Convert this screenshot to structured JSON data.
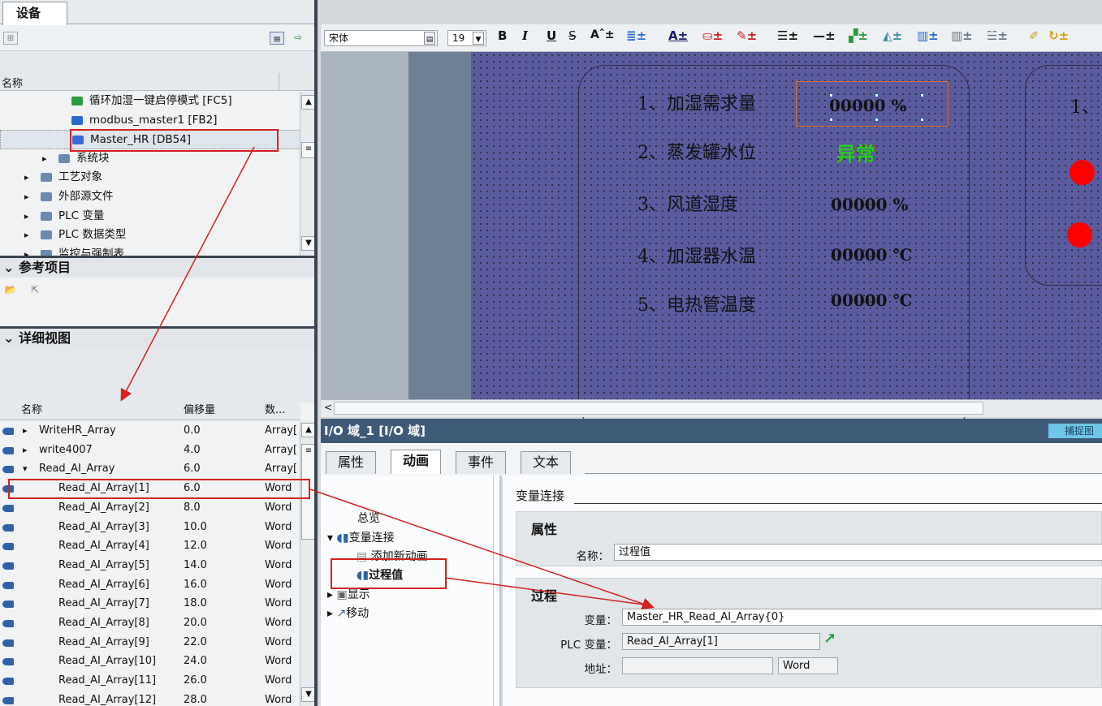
{
  "left_panel": {
    "tab_label": "设备",
    "tree_header": "名称",
    "tree_items": [
      {
        "label": "循环加湿一键启停模式 [FC5]",
        "indent": 88,
        "arrow": "",
        "icon": "fc-icon"
      },
      {
        "label": "modbus_master1 [FB2]",
        "indent": 88,
        "arrow": "",
        "icon": "fb-icon"
      },
      {
        "label": "Master_HR [DB54]",
        "indent": 88,
        "arrow": "",
        "icon": "db-icon"
      },
      {
        "label": "系统块",
        "indent": 72,
        "arrow": "▸",
        "icon": "folder-icon"
      },
      {
        "label": "工艺对象",
        "indent": 50,
        "arrow": "▸",
        "icon": "folder-icon"
      },
      {
        "label": "外部源文件",
        "indent": 50,
        "arrow": "▸",
        "icon": "folder-icon"
      },
      {
        "label": "PLC 变量",
        "indent": 50,
        "arrow": "▸",
        "icon": "folder-icon"
      },
      {
        "label": "PLC 数据类型",
        "indent": 50,
        "arrow": "▸",
        "icon": "folder-icon"
      },
      {
        "label": "监控与强制表",
        "indent": 50,
        "arrow": "▸",
        "icon": "folder-icon"
      }
    ],
    "ref_panel_title": "参考项目",
    "detail_panel_title": "详细视图",
    "detail_headers": {
      "name": "名称",
      "offset": "偏移量",
      "type": "数..."
    },
    "detail_rows": [
      {
        "arrow": "▸",
        "name": "WriteHR_Array",
        "offset": "0.0",
        "type": "Array[",
        "indent": 48
      },
      {
        "arrow": "▸",
        "name": "write4007",
        "offset": "4.0",
        "type": "Array[",
        "indent": 48
      },
      {
        "arrow": "▾",
        "name": "Read_AI_Array",
        "offset": "6.0",
        "type": "Array[",
        "indent": 48
      },
      {
        "arrow": "",
        "name": "Read_AI_Array[1]",
        "offset": "6.0",
        "type": "Word",
        "indent": 72
      },
      {
        "arrow": "",
        "name": "Read_AI_Array[2]",
        "offset": "8.0",
        "type": "Word",
        "indent": 72
      },
      {
        "arrow": "",
        "name": "Read_AI_Array[3]",
        "offset": "10.0",
        "type": "Word",
        "indent": 72
      },
      {
        "arrow": "",
        "name": "Read_AI_Array[4]",
        "offset": "12.0",
        "type": "Word",
        "indent": 72
      },
      {
        "arrow": "",
        "name": "Read_AI_Array[5]",
        "offset": "14.0",
        "type": "Word",
        "indent": 72
      },
      {
        "arrow": "",
        "name": "Read_AI_Array[6]",
        "offset": "16.0",
        "type": "Word",
        "indent": 72
      },
      {
        "arrow": "",
        "name": "Read_AI_Array[7]",
        "offset": "18.0",
        "type": "Word",
        "indent": 72
      },
      {
        "arrow": "",
        "name": "Read_AI_Array[8]",
        "offset": "20.0",
        "type": "Word",
        "indent": 72
      },
      {
        "arrow": "",
        "name": "Read_AI_Array[9]",
        "offset": "22.0",
        "type": "Word",
        "indent": 72
      },
      {
        "arrow": "",
        "name": "Read_AI_Array[10]",
        "offset": "24.0",
        "type": "Word",
        "indent": 72
      },
      {
        "arrow": "",
        "name": "Read_AI_Array[11]",
        "offset": "26.0",
        "type": "Word",
        "indent": 72
      },
      {
        "arrow": "",
        "name": "Read_AI_Array[12]",
        "offset": "28.0",
        "type": "Word",
        "indent": 72
      }
    ]
  },
  "format_bar": {
    "font_name": "宋体",
    "font_size": "19",
    "bold": "B",
    "italic": "I",
    "underline": "U",
    "strike": "S"
  },
  "canvas": {
    "rows": [
      {
        "label": "1、加湿需求量",
        "value": "00000 %"
      },
      {
        "label": "2、蒸发罐水位",
        "value": "异常"
      },
      {
        "label": "3、风道湿度",
        "value": "00000 %"
      },
      {
        "label": "4、加湿器水温",
        "value": "00000 ℃"
      },
      {
        "label": "5、电热管温度",
        "value": "00000 ℃"
      }
    ],
    "right_box_label": "1、",
    "indicator_color": "#ff0000"
  },
  "inspector": {
    "title": "I/O 域_1 [I/O 域]",
    "capture_button": "捕捉图",
    "tabs": [
      "属性",
      "动画",
      "事件",
      "文本"
    ],
    "active_tab": "动画",
    "nav": {
      "overview": "总览",
      "variable_connection": "变量连接",
      "add_animation": "添加新动画",
      "process_value": "过程值",
      "display": "显示",
      "movement": "移动"
    },
    "section_title": "变量连接",
    "properties_group": "属性",
    "name_label": "名称：",
    "name_value": "过程值",
    "process_group": "过程",
    "variable_label": "变量：",
    "variable_value": "Master_HR_Read_AI_Array{0}",
    "plc_var_label": "PLC 变量：",
    "plc_var_value": "Read_AI_Array[1]",
    "address_label": "地址：",
    "address_value": "",
    "address_type": "Word"
  },
  "colors": {
    "canvas_bg": "#5a5c9e",
    "highlight_red": "#d42020",
    "inspector_bar": "#3e5a78"
  }
}
